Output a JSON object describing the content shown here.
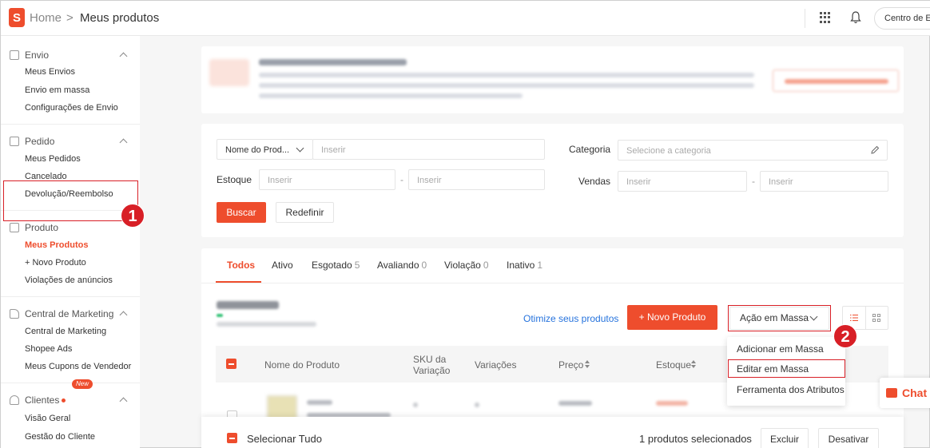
{
  "header": {
    "logo_letter": "S",
    "breadcrumb_home": "Home",
    "breadcrumb_sep": ">",
    "breadcrumb_page": "Meus produtos",
    "center_button": "Centro de Edu"
  },
  "sidebar": {
    "envio": {
      "title": "Envio",
      "items": [
        "Meus Envios",
        "Envio em massa",
        "Configurações de Envio"
      ]
    },
    "pedido": {
      "title": "Pedido",
      "items": [
        "Meus Pedidos",
        "Cancelado",
        "Devolução/Reembolso"
      ]
    },
    "produto": {
      "title": "Produto",
      "items": [
        "Meus Produtos",
        "+ Novo Produto",
        "Violações de anúncios"
      ]
    },
    "marketing": {
      "title": "Central de Marketing",
      "items": [
        "Central de Marketing",
        "Shopee Ads",
        "Meus Cupons de Vendedor"
      ]
    },
    "clientes": {
      "title": "Clientes",
      "items": [
        "Visão Geral",
        "Gestão do Cliente"
      ],
      "new_tag": "New"
    }
  },
  "annotations": {
    "step1": "1",
    "step2": "2"
  },
  "filters": {
    "name_select": "Nome do Prod...",
    "name_placeholder": "Inserir",
    "category_label": "Categoria",
    "category_placeholder": "Selecione a categoria",
    "stock_label": "Estoque",
    "stock_min_placeholder": "Inserir",
    "stock_max_placeholder": "Inserir",
    "sales_label": "Vendas",
    "sales_min_placeholder": "Inserir",
    "sales_max_placeholder": "Inserir",
    "range_dash": "-",
    "search_button": "Buscar",
    "reset_button": "Redefinir"
  },
  "tabs": [
    {
      "label": "Todos",
      "count": ""
    },
    {
      "label": "Ativo",
      "count": ""
    },
    {
      "label": "Esgotado",
      "count": "5"
    },
    {
      "label": "Avaliando",
      "count": "0"
    },
    {
      "label": "Violação",
      "count": "0"
    },
    {
      "label": "Inativo",
      "count": "1"
    }
  ],
  "toolbar": {
    "optimize_link": "Otimize seus produtos",
    "new_product_button": "+ Novo Produto",
    "bulk_action_button": "Ação em Massa"
  },
  "table": {
    "headers": [
      "Nome do Produto",
      "SKU da Variação",
      "Variações",
      "Preço",
      "Estoque"
    ]
  },
  "bulk_menu": {
    "items": [
      "Adicionar em Massa",
      "Editar em Massa",
      "Ferramenta dos Atributos"
    ]
  },
  "bottom_bar": {
    "select_all": "Selecionar Tudo",
    "selected_count": "1 produtos selecionados",
    "delete_button": "Excluir",
    "deactivate_button": "Desativar"
  },
  "chat": {
    "label": "Chat"
  },
  "colors": {
    "brand": "#ee4d2d",
    "link": "#2673dd",
    "annotation": "#d81f26"
  }
}
